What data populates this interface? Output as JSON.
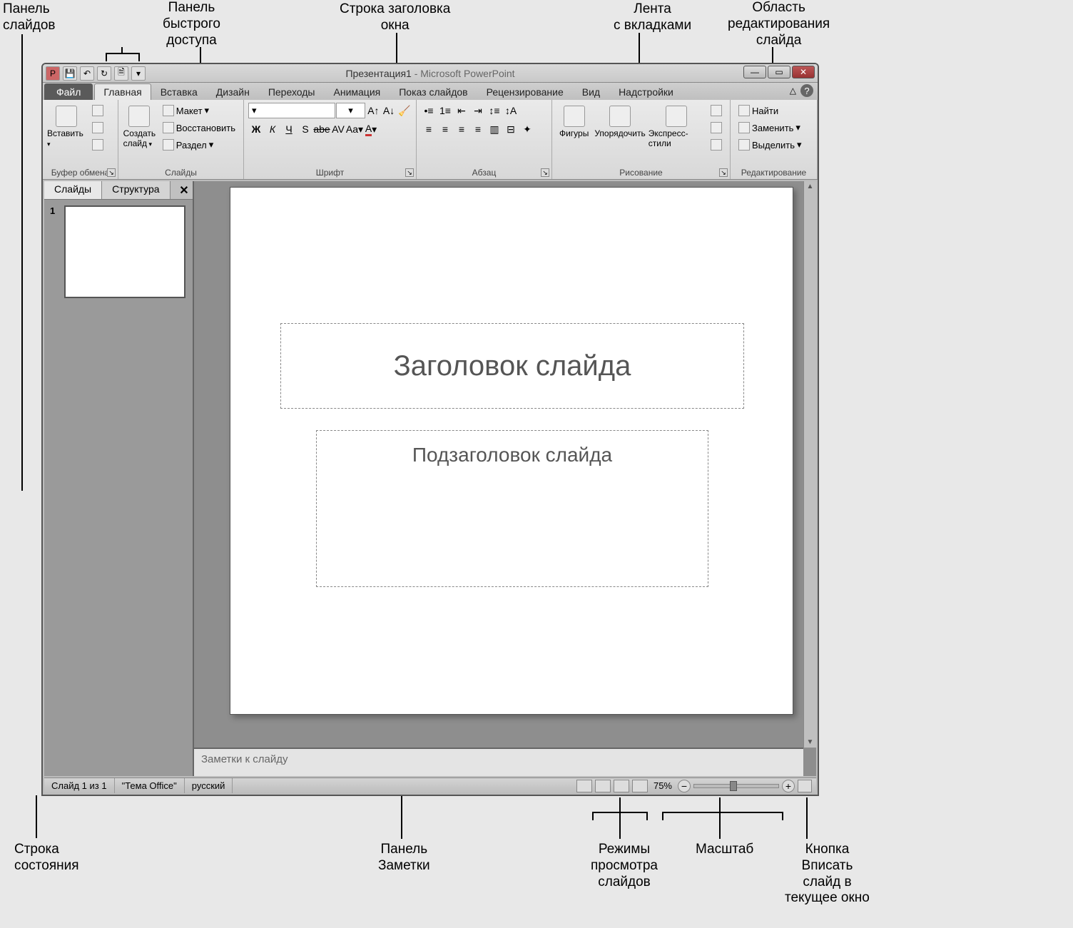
{
  "callouts": {
    "slides_panel": "Панель\nслайдов",
    "qat": "Панель\nбыстрого\nдоступа",
    "titlebar": "Строка заголовка\nокна",
    "ribbon": "Лента\nс вкладками",
    "edit_area": "Область\nредактирования\nслайда",
    "statusbar": "Строка\nсостояния",
    "notes": "Панель\nЗаметки",
    "viewmodes": "Режимы\nпросмотра\nслайдов",
    "zoom": "Масштаб",
    "fit": "Кнопка\nВписать\nслайд в\nтекущее окно"
  },
  "title": {
    "doc": "Презентация1",
    "sep": " - ",
    "app": "Microsoft PowerPoint"
  },
  "tabs": {
    "file": "Файл",
    "items": [
      "Главная",
      "Вставка",
      "Дизайн",
      "Переходы",
      "Анимация",
      "Показ слайдов",
      "Рецензирование",
      "Вид",
      "Надстройки"
    ],
    "active": "Главная"
  },
  "ribbon": {
    "clipboard": {
      "label": "Буфер обмена",
      "paste": "Вставить"
    },
    "slides": {
      "label": "Слайды",
      "newslide": "Создать\nслайд",
      "layout": "Макет",
      "reset": "Восстановить",
      "section": "Раздел"
    },
    "font": {
      "label": "Шрифт",
      "bold": "Ж",
      "italic": "К",
      "underline": "Ч",
      "shadow": "S",
      "strike": "abe",
      "spacing": "AV",
      "case": "Aa",
      "color": "A"
    },
    "para": {
      "label": "Абзац"
    },
    "drawing": {
      "label": "Рисование",
      "shapes": "Фигуры",
      "arrange": "Упорядочить",
      "styles": "Экспресс-стили"
    },
    "edit": {
      "label": "Редактирование",
      "find": "Найти",
      "replace": "Заменить",
      "select": "Выделить"
    }
  },
  "side": {
    "tabs": [
      "Слайды",
      "Структура"
    ],
    "slide_num": "1"
  },
  "slide": {
    "title_ph": "Заголовок слайда",
    "subtitle_ph": "Подзаголовок слайда"
  },
  "notes": {
    "placeholder": "Заметки к слайду"
  },
  "status": {
    "slide": "Слайд 1 из 1",
    "theme": "\"Тема Office\"",
    "lang": "русский",
    "zoom": "75%"
  }
}
